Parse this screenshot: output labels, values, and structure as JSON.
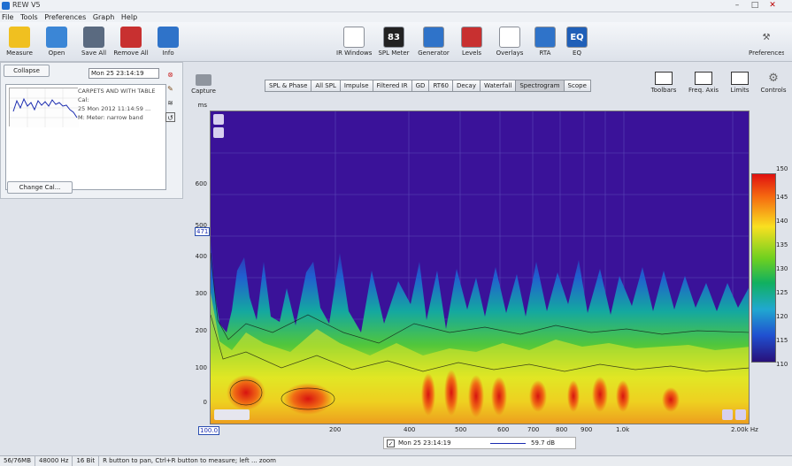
{
  "window": {
    "title": "REW V5"
  },
  "menu": [
    "File",
    "Tools",
    "Preferences",
    "Graph",
    "Help"
  ],
  "toolbar": {
    "left": [
      {
        "name": "measure",
        "label": "Measure",
        "color": "#f0c020"
      },
      {
        "name": "open",
        "label": "Open",
        "color": "#3b86d6"
      },
      {
        "name": "save-all",
        "label": "Save All",
        "color": "#5a6a80"
      },
      {
        "name": "remove-all",
        "label": "Remove All",
        "color": "#c83030"
      },
      {
        "name": "info",
        "label": "Info",
        "color": "#2f73c9"
      }
    ],
    "center": [
      {
        "name": "ir-windows",
        "label": "IR Windows",
        "color": "#ffffff"
      },
      {
        "name": "spl-meter",
        "label": "SPL Meter",
        "glyph": "83",
        "color": "#222222"
      },
      {
        "name": "generator",
        "label": "Generator",
        "color": "#2f73c9"
      },
      {
        "name": "levels",
        "label": "Levels",
        "color": "#c83030"
      },
      {
        "name": "overlays",
        "label": "Overlays",
        "color": "#ffffff"
      },
      {
        "name": "rta",
        "label": "RTA",
        "color": "#2f73c9"
      },
      {
        "name": "eq",
        "label": "EQ",
        "glyph": "EQ",
        "color": "#1f5fb8"
      }
    ],
    "preferences_label": "Preferences"
  },
  "panel": {
    "collapse_label": "Collapse",
    "measurement_name": "Mon 25 23:14:19",
    "lines": [
      "CARPETS AND WITH TABLE",
      "Cal:",
      "25 Mon 2012 11:14:59 ...",
      "M: Meter: narrow band"
    ],
    "change_cal_label": "Change Cal..."
  },
  "capture_label": "Capture",
  "tabs": [
    "SPL & Phase",
    "All SPL",
    "Impulse",
    "Filtered IR",
    "GD",
    "RT60",
    "Decay",
    "Waterfall",
    "Spectrogram",
    "Scope"
  ],
  "active_tab": "Spectrogram",
  "right_tools": [
    {
      "name": "controls-toggle",
      "label": "Toolbars"
    },
    {
      "name": "freq-axis",
      "label": "Freq. Axis"
    },
    {
      "name": "limits",
      "label": "Limits"
    },
    {
      "name": "controls",
      "label": "Controls"
    }
  ],
  "axes": {
    "y_unit": "ms",
    "y_ticks": [
      "600",
      "500",
      "400",
      "300",
      "200",
      "100",
      "0"
    ],
    "y_cursor": "471",
    "x_ticks": [
      "100",
      "200",
      "400",
      "500",
      "600",
      "700",
      "800",
      "900",
      "1.0k",
      "2.00k Hz"
    ],
    "x_cursor": "100.0"
  },
  "colorbar": {
    "ticks": [
      "150",
      "145",
      "140",
      "135",
      "130",
      "125",
      "120",
      "115",
      "110"
    ]
  },
  "legend": {
    "name": "Mon 25 23:14:19",
    "value": "59.7 dB"
  },
  "status": [
    "56/76MB",
    "48000 Hz",
    "16 Bit",
    "R button to pan, Ctrl+R button to measure; left ... zoom"
  ]
}
